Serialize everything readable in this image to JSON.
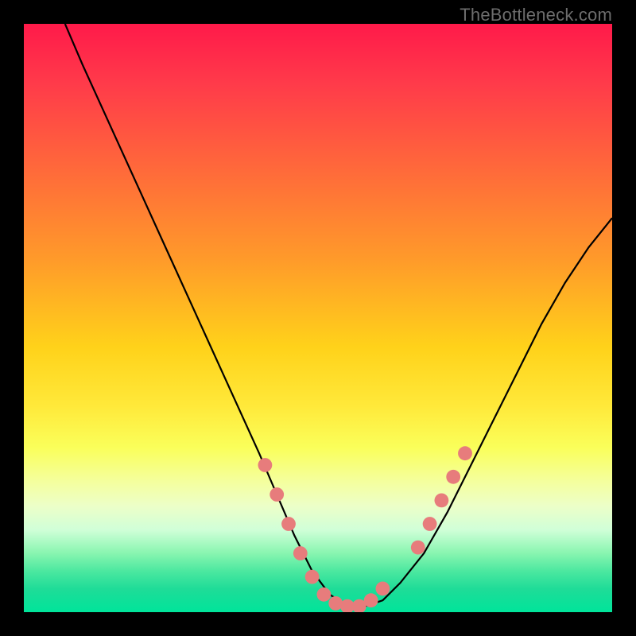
{
  "watermark": "TheBottleneck.com",
  "chart_data": {
    "type": "line",
    "title": "",
    "xlabel": "",
    "ylabel": "",
    "xlim": [
      0,
      100
    ],
    "ylim": [
      0,
      100
    ],
    "series": [
      {
        "name": "curve",
        "color": "#000000",
        "x": [
          7,
          10,
          15,
          20,
          25,
          30,
          35,
          40,
          43,
          46,
          49,
          52,
          55,
          58,
          61,
          64,
          68,
          72,
          76,
          80,
          84,
          88,
          92,
          96,
          100
        ],
        "y": [
          100,
          93,
          82,
          71,
          60,
          49,
          38,
          27,
          20,
          13,
          7,
          3,
          1,
          1,
          2,
          5,
          10,
          17,
          25,
          33,
          41,
          49,
          56,
          62,
          67
        ]
      }
    ],
    "markers": {
      "name": "highlight-points",
      "color": "#e77c7c",
      "radius_pct": 1.2,
      "points": [
        {
          "x": 41,
          "y": 25
        },
        {
          "x": 43,
          "y": 20
        },
        {
          "x": 45,
          "y": 15
        },
        {
          "x": 47,
          "y": 10
        },
        {
          "x": 49,
          "y": 6
        },
        {
          "x": 51,
          "y": 3
        },
        {
          "x": 53,
          "y": 1.5
        },
        {
          "x": 55,
          "y": 1
        },
        {
          "x": 57,
          "y": 1
        },
        {
          "x": 59,
          "y": 2
        },
        {
          "x": 61,
          "y": 4
        },
        {
          "x": 67,
          "y": 11
        },
        {
          "x": 69,
          "y": 15
        },
        {
          "x": 71,
          "y": 19
        },
        {
          "x": 73,
          "y": 23
        },
        {
          "x": 75,
          "y": 27
        }
      ]
    }
  }
}
